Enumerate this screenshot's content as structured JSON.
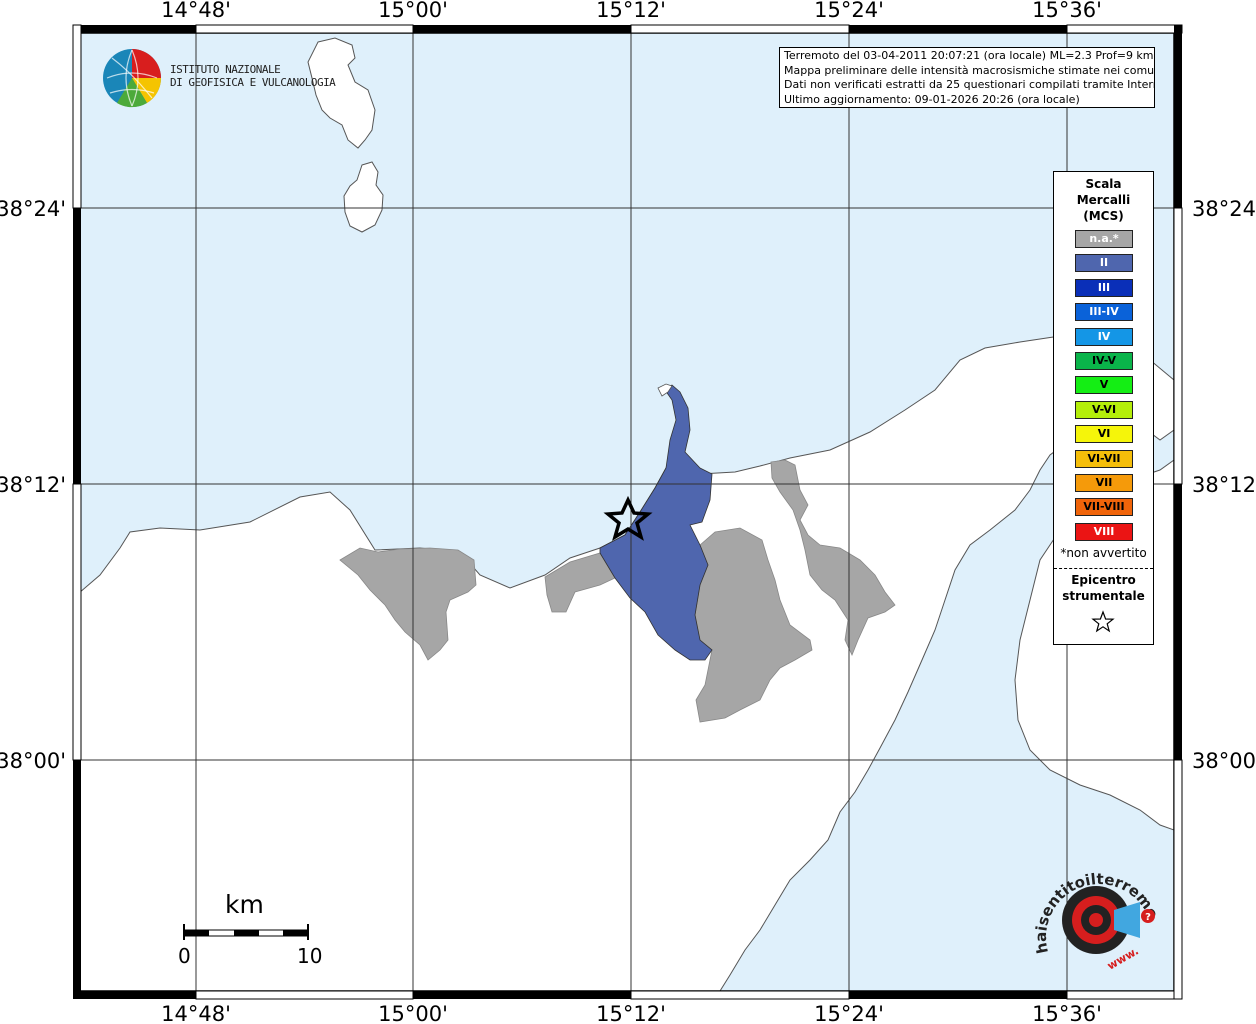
{
  "map": {
    "top_ticks": [
      "14°48'",
      "15°00'",
      "15°12'",
      "15°24'",
      "15°36'"
    ],
    "bottom_ticks": [
      "14°48'",
      "15°00'",
      "15°12'",
      "15°24'",
      "15°36'"
    ],
    "left_ticks": [
      "38°24'",
      "38°12'",
      "38°00'"
    ],
    "right_ticks": [
      "38°24'",
      "38°12'",
      "38°00'"
    ],
    "colors": {
      "sea": "#dff0fb",
      "land": "#ffffff",
      "na": "#a6a6a6",
      "intensity_II": "#4f66ae"
    }
  },
  "institute": {
    "line1": "ISTITUTO NAZIONALE",
    "line2": "DI GEOFISICA E VULCANOLOGIA"
  },
  "info": {
    "line1": "Terremoto del 03-04-2011 20:07:21 (ora locale) ML=2.3 Prof=9 km",
    "line2": "Mappa preliminare delle intensità macrosismiche stimate nei comuni",
    "line3": "Dati non verificati estratti da 25 questionari compilati tramite Internet.",
    "line4": "Ultimo aggiornamento: 09-01-2026 20:26 (ora locale)"
  },
  "legend": {
    "title": "Scala\nMercalli\n(MCS)",
    "items": [
      {
        "label": "n.a.*",
        "color": "#a6a6a6"
      },
      {
        "label": "II",
        "color": "#4f66ae"
      },
      {
        "label": "III",
        "color": "#0a2fb8"
      },
      {
        "label": "III-IV",
        "color": "#0a62d9"
      },
      {
        "label": "IV",
        "color": "#1496e6"
      },
      {
        "label": "IV-V",
        "color": "#0ab44a"
      },
      {
        "label": "V",
        "color": "#14ee14"
      },
      {
        "label": "V-VI",
        "color": "#b4ee0a"
      },
      {
        "label": "VI",
        "color": "#f5f50a"
      },
      {
        "label": "VI-VII",
        "color": "#f5be0a"
      },
      {
        "label": "VII",
        "color": "#f59a0a"
      },
      {
        "label": "VII-VIII",
        "color": "#f0640a"
      },
      {
        "label": "VIII",
        "color": "#eb1414"
      }
    ],
    "na_note": "*non avvertito",
    "epicenter_title": "Epicentro\nstrumentale"
  },
  "scale": {
    "unit": "km",
    "start": "0",
    "end": "10"
  },
  "hst_logo": {
    "text": "haisentitoilterremoto.it",
    "prefix": "www."
  }
}
